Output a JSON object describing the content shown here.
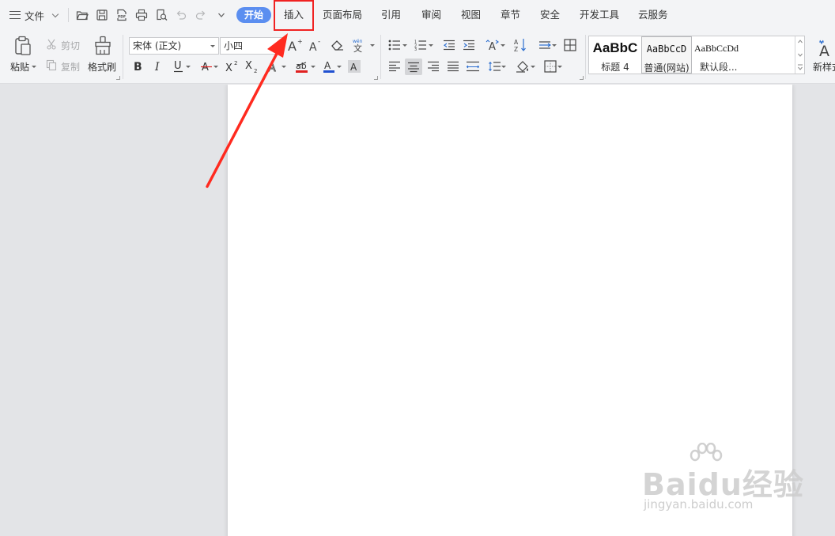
{
  "menubar": {
    "file_label": "文件",
    "active_tab": "开始",
    "tabs": [
      "插入",
      "页面布局",
      "引用",
      "审阅",
      "视图",
      "章节",
      "安全",
      "开发工具",
      "云服务"
    ],
    "highlighted_tab": "插入"
  },
  "ribbon": {
    "clipboard": {
      "paste": "粘贴",
      "cut": "剪切",
      "copy": "复制",
      "format_painter": "格式刷"
    },
    "font": {
      "font_name": "宋体 (正文)",
      "font_size": "小四"
    },
    "styles": [
      {
        "preview": "AaBbC",
        "name": "标题 4"
      },
      {
        "preview": "AaBbCcD",
        "name": "普通(网站)"
      },
      {
        "preview": "AaBbCcDd",
        "name": "默认段..."
      }
    ],
    "new_style": "新样式"
  },
  "watermark": {
    "main": "Baidu经验",
    "sub": "jingyan.baidu.com"
  },
  "colors": {
    "accent": "#5b8ef0",
    "highlight_box": "#f02222",
    "annotation_arrow": "#ff2a1f",
    "font_color_red": "#e02020",
    "font_color_blue": "#2050d0"
  },
  "icons": {
    "quick_access": [
      "folder-open-icon",
      "save-icon",
      "pdf-icon",
      "print-icon",
      "print-preview-icon",
      "undo-icon",
      "redo-icon",
      "customize-icon"
    ]
  }
}
